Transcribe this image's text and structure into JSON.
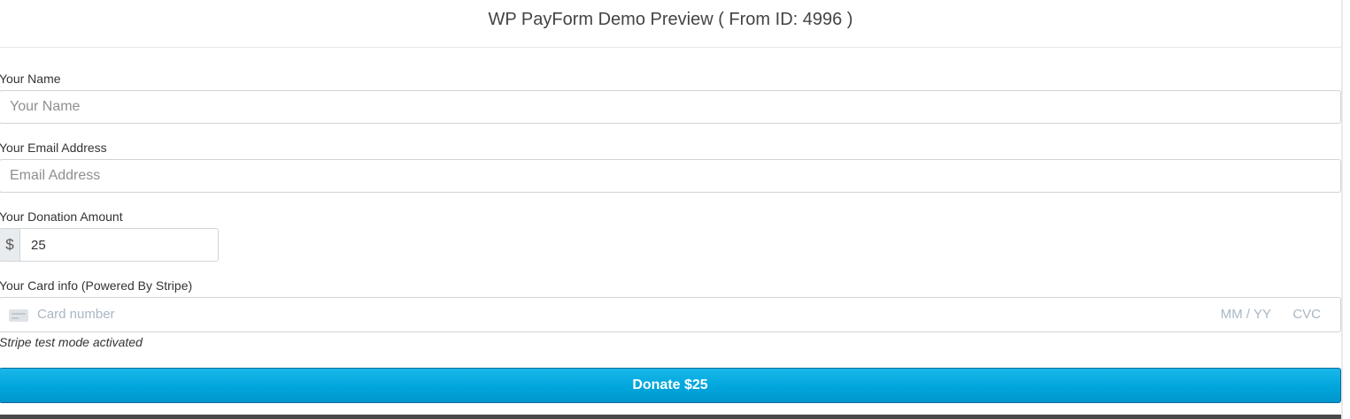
{
  "header": {
    "title": "WP PayForm Demo Preview ( From ID: 4996 )"
  },
  "form": {
    "name_field": {
      "label": "Your Name",
      "placeholder": "Your Name",
      "value": ""
    },
    "email_field": {
      "label": "Your Email Address",
      "placeholder": "Email Address",
      "value": ""
    },
    "amount_field": {
      "label": "Your Donation Amount",
      "currency_symbol": "$",
      "value": "25"
    },
    "card_field": {
      "label": "Your Card info (Powered By Stripe)",
      "card_icon": "credit-card-icon",
      "number_placeholder": "Card number",
      "expiry_placeholder": "MM / YY",
      "cvc_placeholder": "CVC"
    },
    "test_mode_note": "Stripe test mode activated",
    "submit_label": "Donate $25"
  },
  "colors": {
    "button_bg": "#00a6dd",
    "button_border": "#0a6a99",
    "button_text": "#ffffff",
    "stripe_placeholder": "#aab7c4"
  }
}
